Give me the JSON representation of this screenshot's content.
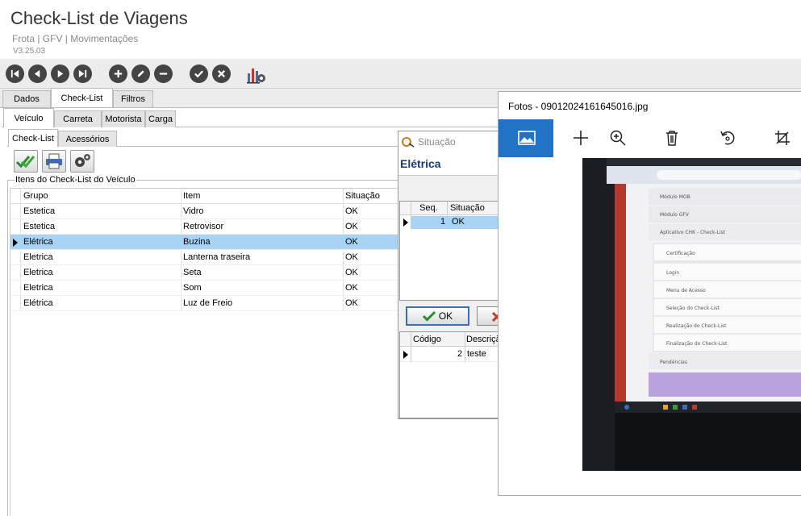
{
  "header": {
    "title": "Check-List de Viagens",
    "breadcrumb": "Frota | GFV | Movimentações",
    "version": "V3.25.03"
  },
  "toolbar": {
    "buttons": [
      "first-icon",
      "previous-icon",
      "next-icon",
      "last-icon",
      "add-icon",
      "edit-icon",
      "remove-icon",
      "confirm-icon",
      "cancel-icon",
      "report-icon"
    ]
  },
  "tabs_main": [
    "Dados",
    "Check-List",
    "Filtros"
  ],
  "tabs_sub": [
    "Veículo",
    "Carreta",
    "Motorista",
    "Carga"
  ],
  "tabs_inner": [
    "Check-List",
    "Acessórios"
  ],
  "groupbox_label": "Itens do Check-List do Veículo",
  "grid": {
    "columns": [
      "Grupo",
      "Item",
      "Situação"
    ],
    "rows": [
      {
        "grupo": "Estetica",
        "item": "Vidro",
        "situacao": "OK"
      },
      {
        "grupo": "Estetica",
        "item": "Retrovisor",
        "situacao": "OK"
      },
      {
        "grupo": "Elétrica",
        "item": "Buzina",
        "situacao": "OK"
      },
      {
        "grupo": "Eletrica",
        "item": "Lanterna traseira",
        "situacao": "OK"
      },
      {
        "grupo": "Eletrica",
        "item": "Seta",
        "situacao": "OK"
      },
      {
        "grupo": "Eletrica",
        "item": "Som",
        "situacao": "OK"
      },
      {
        "grupo": "Elétrica",
        "item": "Luz de Freio",
        "situacao": "OK"
      }
    ]
  },
  "situacao_dialog": {
    "title": "Situação",
    "heading": "Elétrica",
    "grid1": {
      "columns": [
        "Seq.",
        "Situação"
      ],
      "row": {
        "seq": "1",
        "situacao": "OK"
      }
    },
    "ok_label": "OK",
    "grid2": {
      "columns": [
        "Código",
        "Descriçã"
      ],
      "row": {
        "codigo": "2",
        "descricao": "teste"
      }
    }
  },
  "photos": {
    "title": "Fotos - 09012024161645016.jpg",
    "tools": [
      "image-icon",
      "plus-icon",
      "zoom-in-icon",
      "delete-icon",
      "rotate-icon",
      "crop-icon"
    ],
    "photo_lines": [
      "Módulo MOB",
      "Módulo GFV",
      "Aplicativo CHK - Check-List",
      "Certificação",
      "Login",
      "Menu de Acesso",
      "Seleção do Check-List",
      "Realização do Check-List",
      "Finalização do Check-List",
      "Pendências"
    ]
  },
  "colors": {
    "selected_row": "#a9d3f5",
    "photos_accent": "#1f72c4",
    "dialog_heading": "#1a3a6e"
  }
}
